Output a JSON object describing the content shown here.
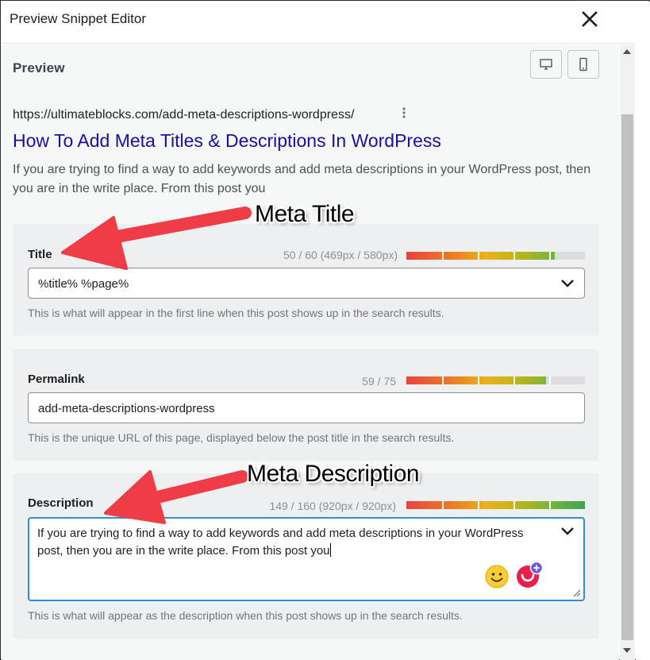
{
  "header": {
    "title": "Preview Snippet Editor",
    "close_icon": "close-icon"
  },
  "preview": {
    "label": "Preview",
    "devices": [
      {
        "name": "desktop",
        "icon": "desktop-icon"
      },
      {
        "name": "mobile",
        "icon": "mobile-icon"
      }
    ],
    "url": "https://ultimateblocks.com/add-meta-descriptions-wordpress/",
    "title": "How To Add Meta Titles & Descriptions In WordPress",
    "description": "If you are trying to find a way to add keywords and add meta descriptions in your WordPress post, then you are in the write place. From this post you",
    "title_color": "#1a0dab"
  },
  "title_field": {
    "label": "Title",
    "counter": "50 / 60 (469px / 580px)",
    "progress": 0.83,
    "value": "%title% %page%",
    "help": "This is what will appear in the first line when this post shows up in the search results."
  },
  "permalink_field": {
    "label": "Permalink",
    "counter": "59 / 75",
    "progress": 0.78,
    "value": "add-meta-descriptions-wordpress",
    "help": "This is the unique URL of this page, displayed below the post title in the search results."
  },
  "description_field": {
    "label": "Description",
    "counter": "149 / 160 (920px / 920px)",
    "progress": 1.0,
    "value": "If you are trying to find a way to add keywords and add meta descriptions in your WordPress post, then you are in the write place. From this post you",
    "help": "This is what will appear as the description when this post shows up in the search results.",
    "focus_color": "#2a8fd6"
  },
  "annotations": {
    "meta_title": "Meta Title",
    "meta_description": "Meta Description",
    "arrow_color": "#f03c46"
  },
  "icons": [
    "close-icon",
    "desktop-icon",
    "mobile-icon",
    "more-vertical-icon",
    "chevron-down-icon",
    "emoji-icon",
    "grammarly-icon",
    "resize-handle-icon"
  ]
}
